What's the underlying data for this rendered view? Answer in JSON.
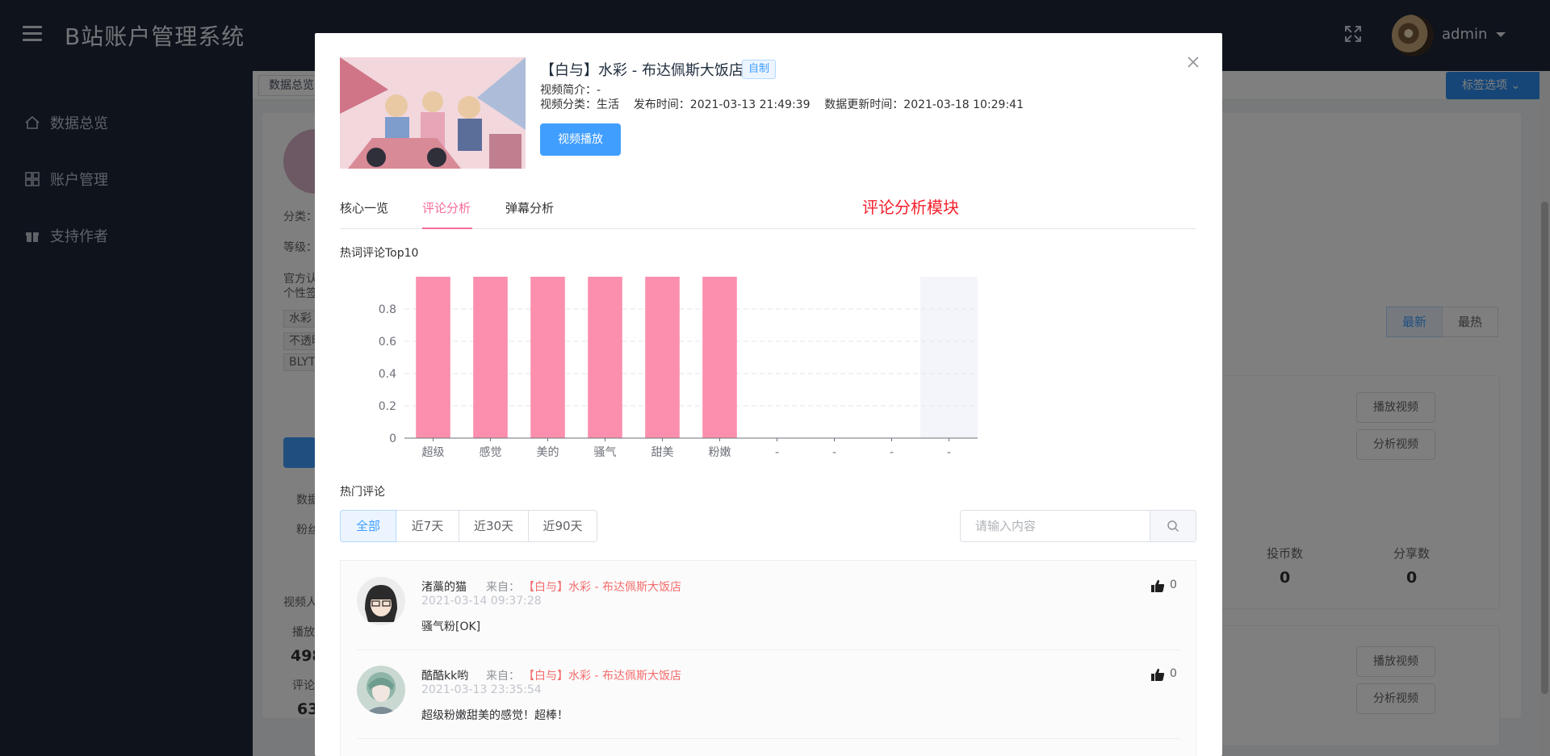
{
  "app": {
    "title": "B站账户管理系统",
    "user": "admin"
  },
  "sidebar": {
    "items": [
      {
        "label": "数据总览"
      },
      {
        "label": "账户管理"
      },
      {
        "label": "支持作者"
      }
    ]
  },
  "background": {
    "tag_first": "数据总览",
    "tag_options": "标签选项",
    "labels": [
      "分类：",
      "等级：",
      "官方认",
      "个性签"
    ],
    "chips": [
      "水彩",
      "不透明",
      "BLYT"
    ],
    "stat_labels": [
      "数据",
      "粉丝",
      "视频人",
      "播放",
      "评论"
    ],
    "stat_values": [
      "498",
      "63."
    ],
    "sort_buttons": [
      "最新",
      "最热"
    ],
    "card_buttons": [
      "播放视频",
      "分析视频",
      "播放视频",
      "分析视频"
    ],
    "metric_labels": [
      "投币数",
      "分享数"
    ],
    "metric_values": [
      "0",
      "0"
    ]
  },
  "dialog": {
    "video": {
      "title": "【白与】水彩 - 布达佩斯大饭店",
      "badge": "自制",
      "intro": "视频简介：-",
      "category_line": "视频分类：生活    发布时间：2021-03-13 21:49:39    数据更新时间：2021-03-18 10:29:41",
      "play_button": "视频播放"
    },
    "tabs": [
      {
        "label": "核心一览",
        "active": false
      },
      {
        "label": "评论分析",
        "active": true
      },
      {
        "label": "弹幕分析",
        "active": false
      }
    ],
    "module_note": "评论分析模块",
    "hotwords_title": "热词评论Top10",
    "hot_comments_title": "热门评论",
    "filters": [
      {
        "label": "全部",
        "active": true
      },
      {
        "label": "近7天",
        "active": false
      },
      {
        "label": "近30天",
        "active": false
      },
      {
        "label": "近90天",
        "active": false
      }
    ],
    "search": {
      "placeholder": "请输入内容",
      "value": ""
    },
    "comments": [
      {
        "user": "渚藁的猫",
        "from_label": "来自：",
        "from_link": "【白与】水彩 - 布达佩斯大饭店",
        "time": "2021-03-14 09:37:28",
        "text": "骚气粉[OK]",
        "likes": "0"
      },
      {
        "user": "酷酷kk哟",
        "from_label": "来自：",
        "from_link": "【白与】水彩 - 布达佩斯大饭店",
        "time": "2021-03-13 23:35:54",
        "text": "超级粉嫩甜美的感觉！超棒！",
        "likes": "0"
      }
    ]
  },
  "chart_data": {
    "type": "bar",
    "title": "热词评论Top10",
    "categories": [
      "超级",
      "感觉",
      "美的",
      "骚气",
      "甜美",
      "粉嫩",
      "-",
      "-",
      "-",
      "-"
    ],
    "values": [
      1,
      1,
      1,
      1,
      1,
      1,
      0,
      0,
      0,
      0
    ],
    "ylim": [
      0,
      1
    ],
    "yticks": [
      "0",
      "0.2",
      "0.4",
      "0.6",
      "0.8"
    ],
    "grid": true,
    "highlighted_category_index": 9,
    "colors": {
      "bar": "#fb8fad",
      "highlight_band": "#f4f5fa",
      "axis": "#6e7079",
      "grid": "#e0e6f1"
    }
  }
}
